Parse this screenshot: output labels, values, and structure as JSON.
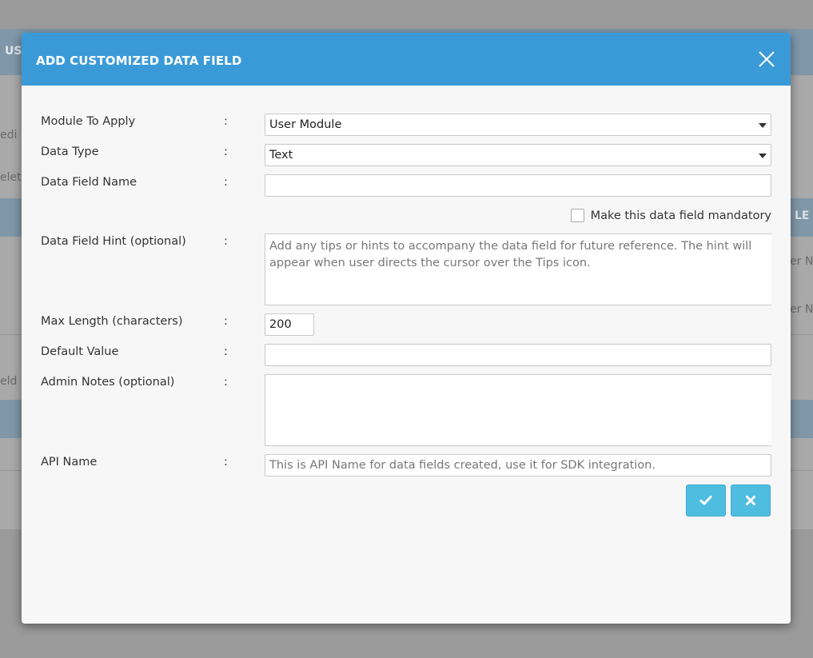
{
  "background": {
    "top_bar_text": "USE",
    "left_snippets": [
      "edi",
      "elet",
      "eld n"
    ],
    "right_snippets": [
      "LE T",
      "er N",
      "er N"
    ]
  },
  "modal": {
    "title": "ADD CUSTOMIZED DATA FIELD",
    "fields": {
      "module": {
        "label": "Module To Apply",
        "colon": ":",
        "value": "User Module"
      },
      "data_type": {
        "label": "Data Type",
        "colon": ":",
        "value": "Text"
      },
      "field_name": {
        "label": "Data Field Name",
        "colon": ":",
        "value": ""
      },
      "mandatory": {
        "label": "Make this data field mandatory",
        "checked": false
      },
      "hint": {
        "label": "Data Field Hint (optional)",
        "colon": ":",
        "placeholder": "Add any tips or hints to accompany the data field for future reference. The hint will appear when user directs the cursor over the Tips icon."
      },
      "max_length": {
        "label": "Max Length (characters)",
        "colon": ":",
        "value": "200"
      },
      "default_value": {
        "label": "Default Value",
        "colon": ":",
        "value": ""
      },
      "admin_notes": {
        "label": "Admin Notes (optional)",
        "colon": ":",
        "value": ""
      },
      "api_name": {
        "label": "API Name",
        "colon": ":",
        "placeholder": "This is API Name for data fields created, use it for SDK integration."
      }
    },
    "buttons": {
      "confirm_icon": "check-icon",
      "cancel_icon": "x-icon"
    }
  },
  "colors": {
    "header": "#3a9ad8",
    "button": "#4fbde0",
    "overlay": "#9b9b9b"
  }
}
